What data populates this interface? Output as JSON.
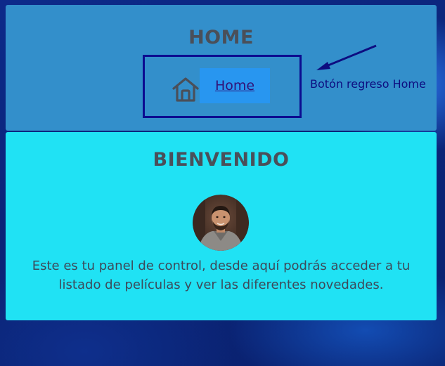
{
  "header": {
    "title": "HOME",
    "home_link_label": "Home",
    "home_icon": "home-icon"
  },
  "annotation": {
    "label": "Botón regreso Home",
    "color": "#0d0d80"
  },
  "welcome": {
    "title": "BIENVENIDO",
    "avatar": "user-avatar",
    "text": "Este es tu panel de control, desde aquí podrás acceder a tu listado de películas y ver las diferentes novedades."
  },
  "colors": {
    "header_panel": "#338fcb",
    "welcome_panel": "#20e2f4",
    "link_button": "#2896f0",
    "link_text": "#321277",
    "heading_text": "#4a4f59",
    "background": "#0b2478"
  }
}
